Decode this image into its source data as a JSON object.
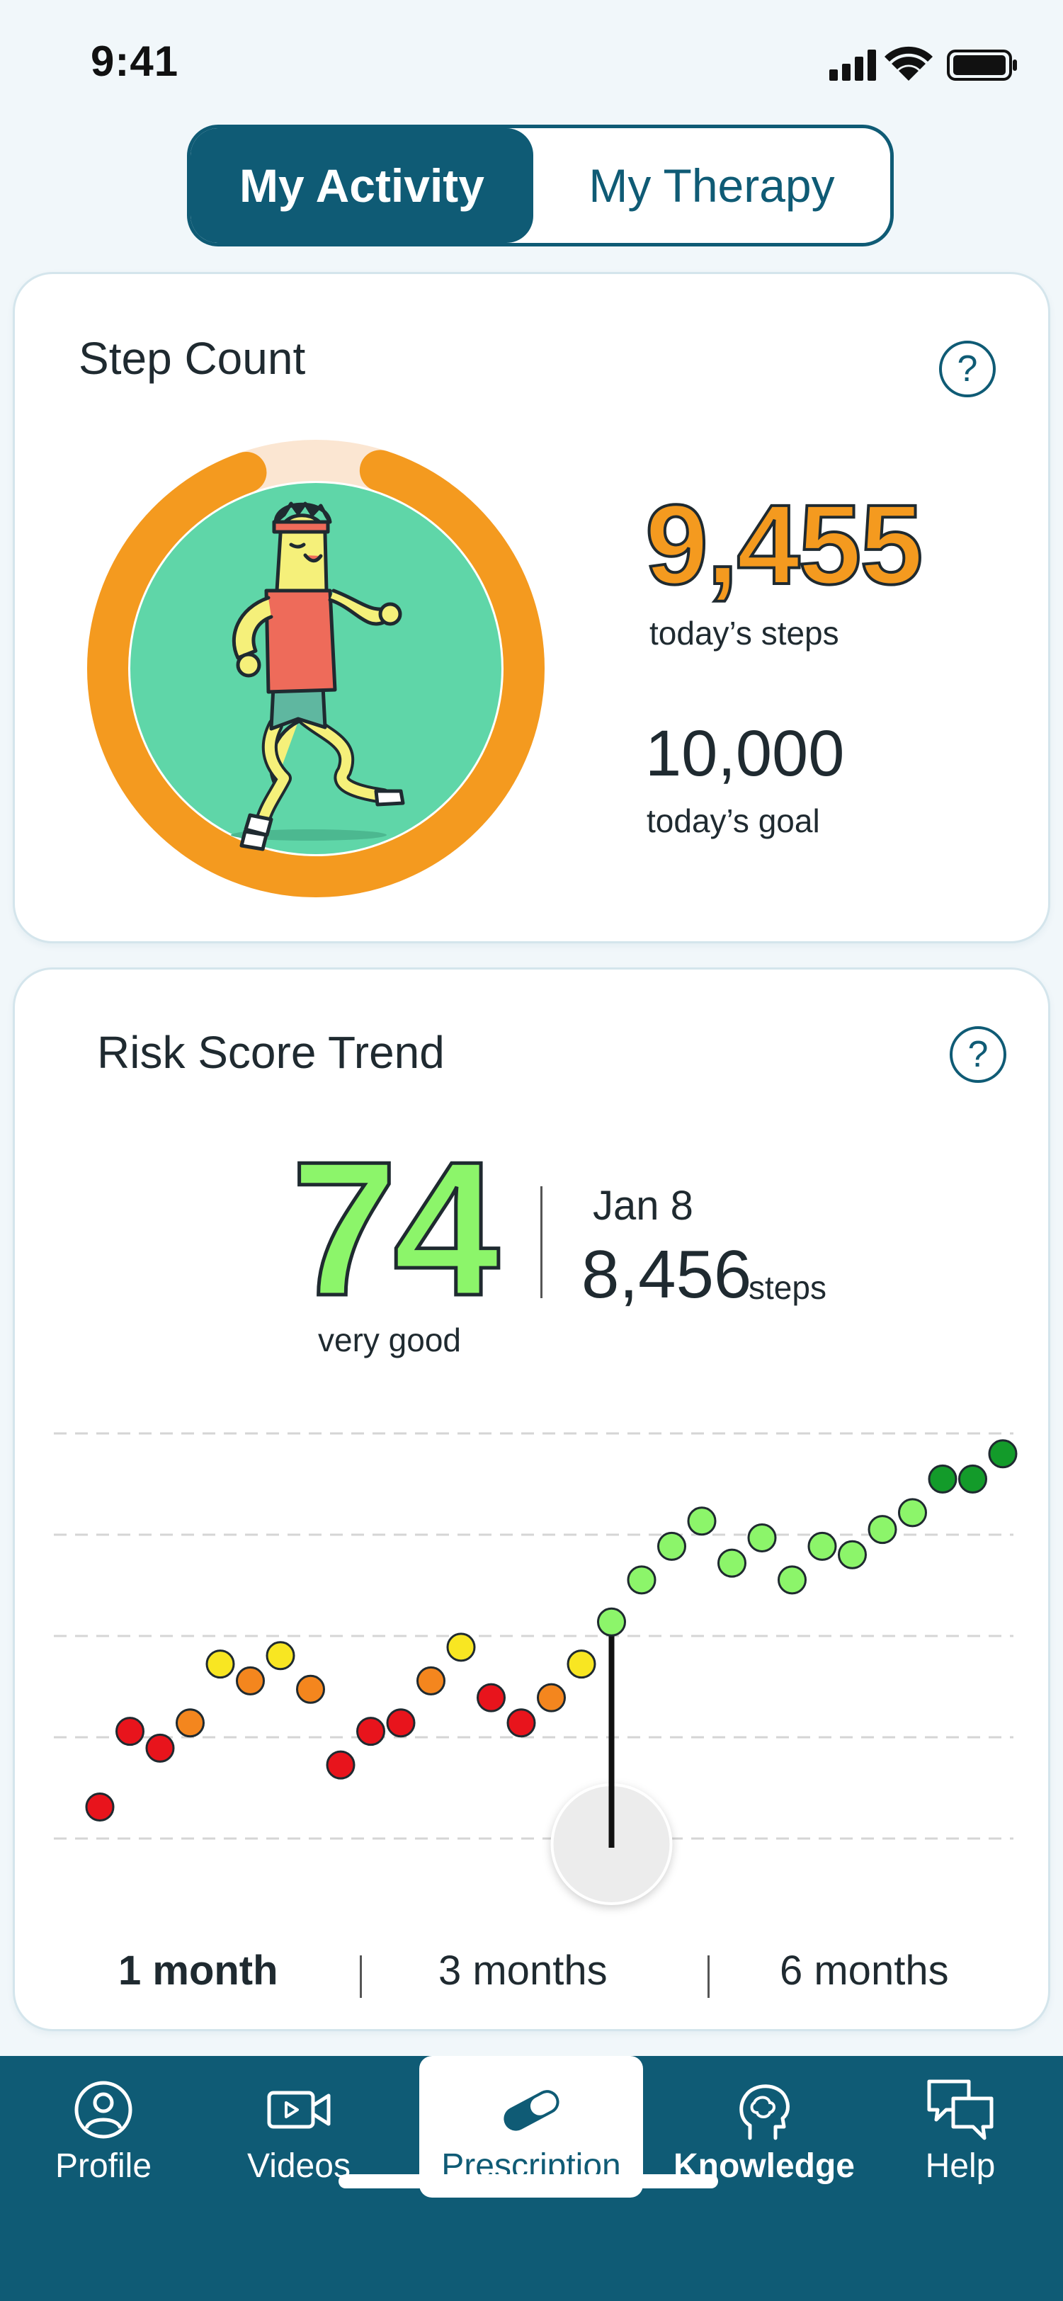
{
  "status_bar": {
    "time": "9:41"
  },
  "tabs": {
    "active": "My Activity",
    "inactive": "My Therapy"
  },
  "step_card": {
    "title": "Step Count",
    "help": "?",
    "steps": "9,455",
    "steps_label": "today’s steps",
    "goal": "10,000",
    "goal_label": "today’s goal",
    "progress": 0.9455
  },
  "risk_card": {
    "title": "Risk Score Trend",
    "help": "?",
    "score": "74",
    "rating": "very good",
    "selected_date": "Jan 8",
    "selected_steps": "8,456",
    "selected_steps_unit": "steps",
    "ranges": [
      "1 month",
      "3 months",
      "6 months"
    ],
    "active_range": "1 month"
  },
  "chart_data": {
    "type": "scatter",
    "title": "Risk Score Trend",
    "x": [
      1,
      2,
      3,
      4,
      5,
      6,
      7,
      8,
      9,
      10,
      11,
      12,
      13,
      14,
      15,
      16,
      17,
      18,
      19,
      20,
      21,
      22,
      23,
      24,
      25,
      26,
      27,
      28,
      29,
      30,
      31
    ],
    "values": [
      14,
      23,
      21,
      24,
      31,
      29,
      32,
      28,
      19,
      23,
      24,
      29,
      33,
      27,
      24,
      27,
      31,
      36,
      41,
      45,
      48,
      43,
      46,
      41,
      45,
      44,
      47,
      49,
      53,
      53,
      56
    ],
    "point_colors": [
      "#e8141c",
      "#e8141c",
      "#e8141c",
      "#f4861e",
      "#f8e622",
      "#f4861e",
      "#f8e622",
      "#f4861e",
      "#e8141c",
      "#e8141c",
      "#e8141c",
      "#f4861e",
      "#f8e622",
      "#e8141c",
      "#e8141c",
      "#f4861e",
      "#f8e622",
      "#8cf56a",
      "#8cf56a",
      "#8cf56a",
      "#8cf56a",
      "#8cf56a",
      "#8cf56a",
      "#8cf56a",
      "#8cf56a",
      "#8cf56a",
      "#8cf56a",
      "#8cf56a",
      "#139b2a",
      "#139b2a",
      "#139b2a"
    ],
    "selected_index": 17,
    "grid": true,
    "ylim": [
      10,
      58
    ]
  },
  "bottom_nav": {
    "items": [
      {
        "label": "Profile",
        "icon": "profile-icon"
      },
      {
        "label": "Videos",
        "icon": "video-icon"
      },
      {
        "label": "Prescription",
        "icon": "pill-icon"
      },
      {
        "label": "Knowledge",
        "icon": "brain-icon"
      },
      {
        "label": "Help",
        "icon": "chat-icon"
      }
    ],
    "active": "Prescription"
  },
  "colors": {
    "primary": "#0f5b75",
    "accent_orange": "#f49a1f",
    "good_green": "#8cf56a",
    "track": "#fbe6d2"
  }
}
